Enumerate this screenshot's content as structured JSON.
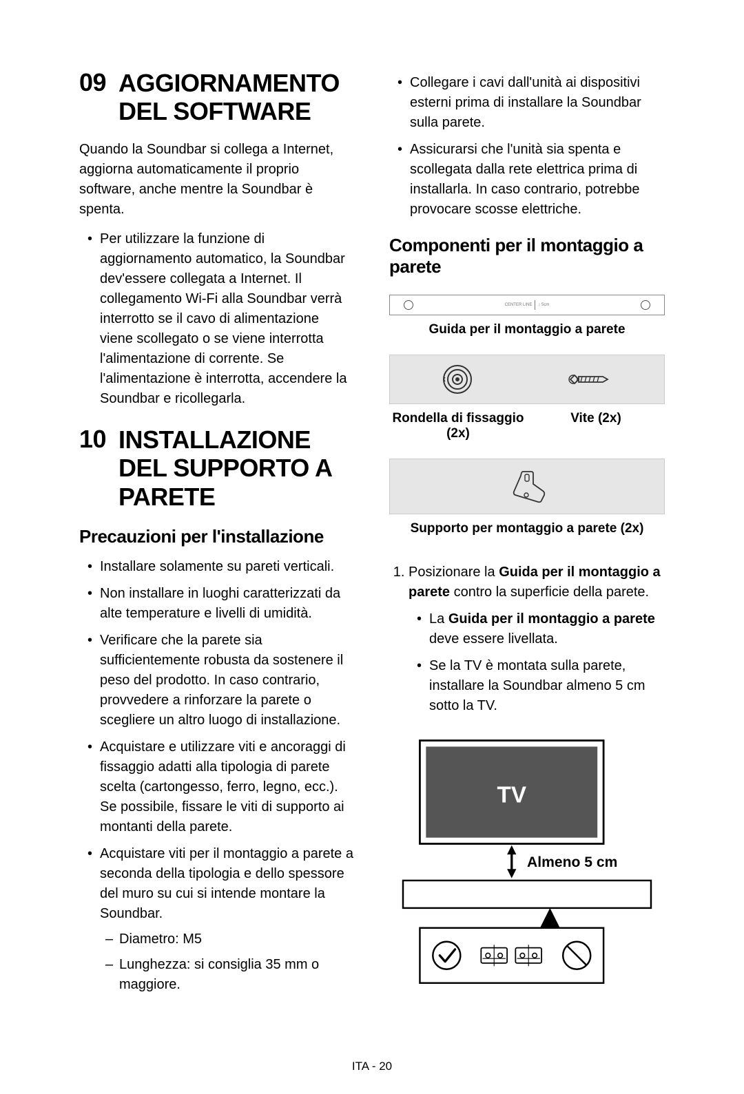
{
  "footer": "ITA - 20",
  "section09": {
    "num": "09",
    "title": "AGGIORNAMENTO DEL SOFTWARE",
    "intro": "Quando la Soundbar si collega a Internet, aggiorna automaticamente il proprio software, anche mentre la Soundbar è spenta.",
    "bullets": [
      "Per utilizzare la funzione di aggiornamento automatico, la Soundbar dev'essere collegata a Internet. Il collegamento Wi-Fi alla Soundbar verrà interrotto se il cavo di alimentazione viene scollegato o se viene interrotta l'alimentazione di corrente. Se l'alimentazione è interrotta, accendere la Soundbar e ricollegarla."
    ]
  },
  "section10": {
    "num": "10",
    "title": "INSTALLAZIONE DEL SUPPORTO A PARETE",
    "subsection1": "Precauzioni per l'installazione",
    "precautions": [
      "Installare solamente su pareti verticali.",
      "Non installare in luoghi caratterizzati da alte temperature e livelli di umidità.",
      "Verificare che la parete sia sufficientemente robusta da sostenere il peso del prodotto. In caso contrario, provvedere a rinforzare la parete o scegliere un altro luogo di installazione.",
      "Acquistare e utilizzare viti e ancoraggi di fissaggio adatti alla tipologia di parete scelta (cartongesso, ferro, legno, ecc.). Se possibile, fissare le viti di supporto ai montanti della parete.",
      "Acquistare viti per il montaggio a parete a seconda della tipologia e dello spessore del muro su cui si intende montare la Soundbar."
    ],
    "subspecs": [
      "Diametro: M5",
      "Lunghezza: si consiglia 35 mm o maggiore."
    ],
    "precautions_right": [
      "Collegare i cavi dall'unità ai dispositivi esterni prima di installare la Soundbar sulla parete.",
      "Assicurarsi che l'unità sia spenta e scollegata dalla rete elettrica prima di installarla. In caso contrario, potrebbe provocare scosse elettriche."
    ],
    "subsection2": "Componenti per il montaggio a parete",
    "components": {
      "guide": "Guida per il montaggio a parete",
      "washer": "Rondella di fissaggio (2x)",
      "screw": "Vite (2x)",
      "bracket": "Supporto per montaggio a parete (2x)"
    },
    "step1_prefix": "Posizionare la ",
    "step1_bold": "Guida per il montaggio a parete",
    "step1_suffix": " contro la superficie della parete.",
    "step1_sub1_prefix": "La ",
    "step1_sub1_bold": "Guida per il montaggio a parete",
    "step1_sub1_suffix": " deve essere livellata.",
    "step1_sub2": "Se la TV è montata sulla parete, installare la Soundbar almeno 5 cm sotto la TV.",
    "diagram_tv": "TV",
    "diagram_gap": "Almeno 5 cm"
  }
}
